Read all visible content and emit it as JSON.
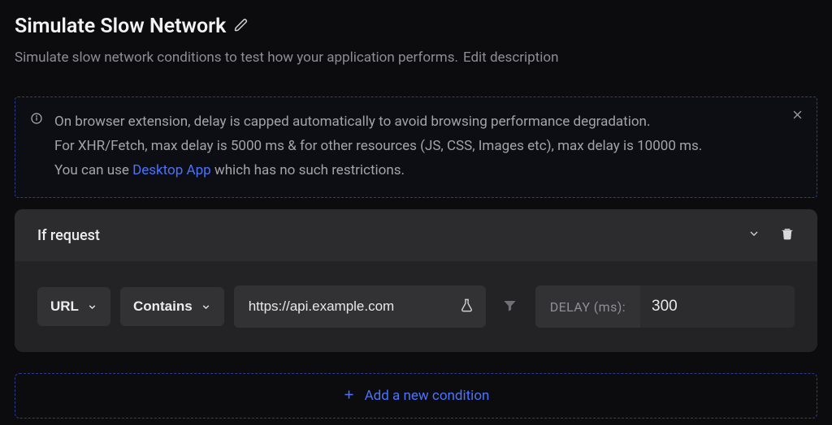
{
  "header": {
    "title": "Simulate Slow Network",
    "description": "Simulate slow network conditions to test how your application performs.",
    "edit_description_label": "Edit description"
  },
  "info": {
    "line1": "On browser extension, delay is capped automatically to avoid browsing performance degradation.",
    "line2": "For XHR/Fetch, max delay is 5000 ms & for other resources (JS, CSS, Images etc), max delay is 10000 ms.",
    "line3_pre": "You can use ",
    "line3_link": "Desktop App",
    "line3_post": " which has no such restrictions."
  },
  "rule": {
    "heading": "If request",
    "condition": {
      "field": "URL",
      "operator": "Contains",
      "value": "https://api.example.com",
      "delay_label": "DELAY (ms):",
      "delay_value": "300"
    }
  },
  "add_condition_label": "Add a new condition"
}
